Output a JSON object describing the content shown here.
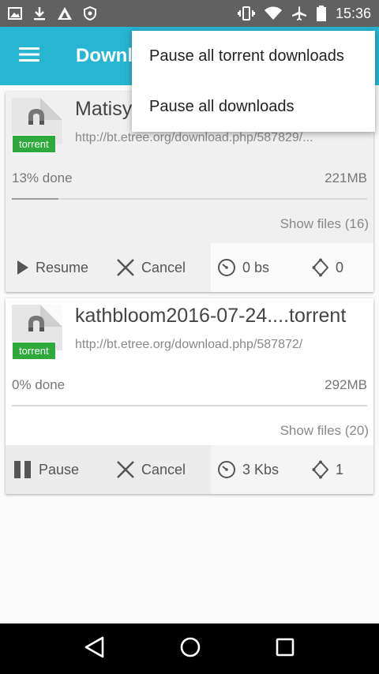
{
  "status_bar": {
    "time": "15:36",
    "left_icons": [
      "image-icon",
      "download-icon",
      "app-icon",
      "shield-icon"
    ],
    "right_icons": [
      "vibrate-icon",
      "wifi-icon",
      "airplane-icon",
      "battery-icon"
    ]
  },
  "app_bar": {
    "title": "Downloads",
    "menu_icon": "hamburger-icon"
  },
  "popup_menu": {
    "items": [
      {
        "label": "Pause all torrent downloads"
      },
      {
        "label": "Pause all downloads"
      }
    ]
  },
  "downloads": [
    {
      "title": "Matisyahu2016-07-24...torrent",
      "tag": "torrent",
      "url": "http://bt.etree.org/download.php/587829/...",
      "progress_text": "13% done",
      "progress": 0.13,
      "size": "221MB",
      "show_files": "Show files (16)",
      "primary_action": "Resume",
      "cancel": "Cancel",
      "speed": "0 bs",
      "peers": "0"
    },
    {
      "title": "kathbloom2016-07-24....torrent",
      "tag": "torrent",
      "url": "http://bt.etree.org/download.php/587872/",
      "progress_text": "0% done",
      "progress": 0.0,
      "size": "292MB",
      "show_files": "Show files (20)",
      "primary_action": "Pause",
      "cancel": "Cancel",
      "speed": "3 Kbs",
      "peers": "1"
    }
  ],
  "nav_bar": {
    "icons": [
      "back-icon",
      "home-icon",
      "recents-icon"
    ]
  }
}
